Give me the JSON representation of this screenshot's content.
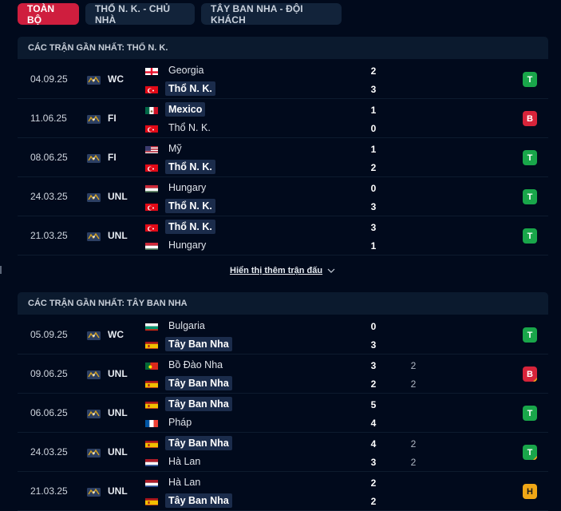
{
  "tabs": [
    {
      "label": "TOÀN BỘ",
      "active": true
    },
    {
      "label": "THỔ N. K. - CHỦ NHÀ",
      "active": false
    },
    {
      "label": "TÂY BAN NHA - ĐỘI KHÁCH",
      "active": false
    }
  ],
  "section1": {
    "title": "CÁC TRẬN GẦN NHẤT: THỔ N. K.",
    "show_more": "Hiển thị thêm trận đấu",
    "matches": [
      {
        "date": "04.09.25",
        "comp": "WC",
        "home": {
          "name": "Georgia",
          "flag": "georgia-flag",
          "score": "2",
          "bold": false
        },
        "away": {
          "name": "Thổ N. K.",
          "flag": "turkey-flag",
          "score": "3",
          "bold": true
        },
        "result": "T"
      },
      {
        "date": "11.06.25",
        "comp": "FI",
        "home": {
          "name": "Mexico",
          "flag": "mexico-flag",
          "score": "1",
          "bold": true
        },
        "away": {
          "name": "Thổ N. K.",
          "flag": "turkey-flag",
          "score": "0",
          "bold": false
        },
        "result": "B"
      },
      {
        "date": "08.06.25",
        "comp": "FI",
        "home": {
          "name": "Mỹ",
          "flag": "usa-flag",
          "score": "1",
          "bold": false
        },
        "away": {
          "name": "Thổ N. K.",
          "flag": "turkey-flag",
          "score": "2",
          "bold": true
        },
        "result": "T"
      },
      {
        "date": "24.03.25",
        "comp": "UNL",
        "home": {
          "name": "Hungary",
          "flag": "hungary-flag",
          "score": "0",
          "bold": false
        },
        "away": {
          "name": "Thổ N. K.",
          "flag": "turkey-flag",
          "score": "3",
          "bold": true
        },
        "result": "T"
      },
      {
        "date": "21.03.25",
        "comp": "UNL",
        "home": {
          "name": "Thổ N. K.",
          "flag": "turkey-flag",
          "score": "3",
          "bold": true
        },
        "away": {
          "name": "Hungary",
          "flag": "hungary-flag",
          "score": "1",
          "bold": false
        },
        "result": "T"
      }
    ]
  },
  "section2": {
    "title": "CÁC TRẬN GẦN NHẤT: TÂY BAN NHA",
    "matches": [
      {
        "date": "05.09.25",
        "comp": "WC",
        "home": {
          "name": "Bulgaria",
          "flag": "bulgaria-flag",
          "score": "0",
          "pen": "",
          "bold": false
        },
        "away": {
          "name": "Tây Ban Nha",
          "flag": "spain-flag",
          "score": "3",
          "pen": "",
          "bold": true
        },
        "result": "T"
      },
      {
        "date": "09.06.25",
        "comp": "UNL",
        "home": {
          "name": "Bồ Đào Nha",
          "flag": "portugal-flag",
          "score": "3",
          "pen": "2",
          "bold": false
        },
        "away": {
          "name": "Tây Ban Nha",
          "flag": "spain-flag",
          "score": "2",
          "pen": "2",
          "bold": true
        },
        "result": "B"
      },
      {
        "date": "06.06.25",
        "comp": "UNL",
        "home": {
          "name": "Tây Ban Nha",
          "flag": "spain-flag",
          "score": "5",
          "pen": "",
          "bold": true
        },
        "away": {
          "name": "Pháp",
          "flag": "france-flag",
          "score": "4",
          "pen": "",
          "bold": false
        },
        "result": "T"
      },
      {
        "date": "24.03.25",
        "comp": "UNL",
        "home": {
          "name": "Tây Ban Nha",
          "flag": "spain-flag",
          "score": "4",
          "pen": "2",
          "bold": true
        },
        "away": {
          "name": "Hà Lan",
          "flag": "netherlands-flag",
          "score": "3",
          "pen": "2",
          "bold": false
        },
        "result": "T"
      },
      {
        "date": "21.03.25",
        "comp": "UNL",
        "home": {
          "name": "Hà Lan",
          "flag": "netherlands-flag",
          "score": "2",
          "pen": "",
          "bold": false
        },
        "away": {
          "name": "Tây Ban Nha",
          "flag": "spain-flag",
          "score": "2",
          "pen": "",
          "bold": true
        },
        "result": "H"
      }
    ]
  },
  "colors": {
    "accent": "#cf1e3e",
    "win": "#19a64a",
    "loss": "#d7243a",
    "draw": "#f0a716",
    "background": "#010a1c"
  }
}
